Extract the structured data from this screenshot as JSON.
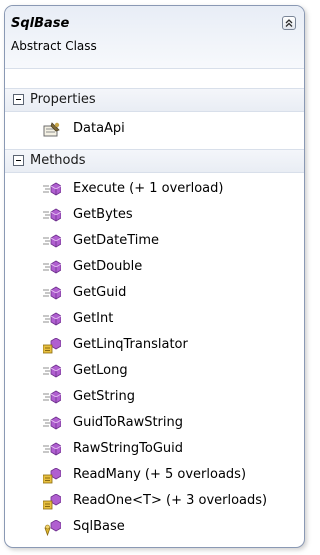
{
  "class_shape": {
    "name": "SqlBase",
    "kind": "Abstract Class"
  },
  "compartments": {
    "properties": {
      "label": "Properties",
      "items": [
        {
          "label": "DataApi",
          "icon": "property-icon"
        }
      ]
    },
    "methods": {
      "label": "Methods",
      "items": [
        {
          "label": "Execute (+ 1 overload)",
          "icon": "method-icon"
        },
        {
          "label": "GetBytes",
          "icon": "method-icon"
        },
        {
          "label": "GetDateTime",
          "icon": "method-icon"
        },
        {
          "label": "GetDouble",
          "icon": "method-icon"
        },
        {
          "label": "GetGuid",
          "icon": "method-icon"
        },
        {
          "label": "GetInt",
          "icon": "method-icon"
        },
        {
          "label": "GetLinqTranslator",
          "icon": "protected-method-icon"
        },
        {
          "label": "GetLong",
          "icon": "method-icon"
        },
        {
          "label": "GetString",
          "icon": "method-icon"
        },
        {
          "label": "GuidToRawString",
          "icon": "method-icon"
        },
        {
          "label": "RawStringToGuid",
          "icon": "method-icon"
        },
        {
          "label": "ReadMany (+ 5 overloads)",
          "icon": "protected-method-icon"
        },
        {
          "label": "ReadOne<T> (+ 3 overloads)",
          "icon": "protected-method-icon"
        },
        {
          "label": "SqlBase",
          "icon": "constructor-icon"
        }
      ]
    }
  },
  "colors": {
    "border": "#8a99b4",
    "method_icon": "#b05fd0",
    "property_icon": "#7a6a3c"
  }
}
